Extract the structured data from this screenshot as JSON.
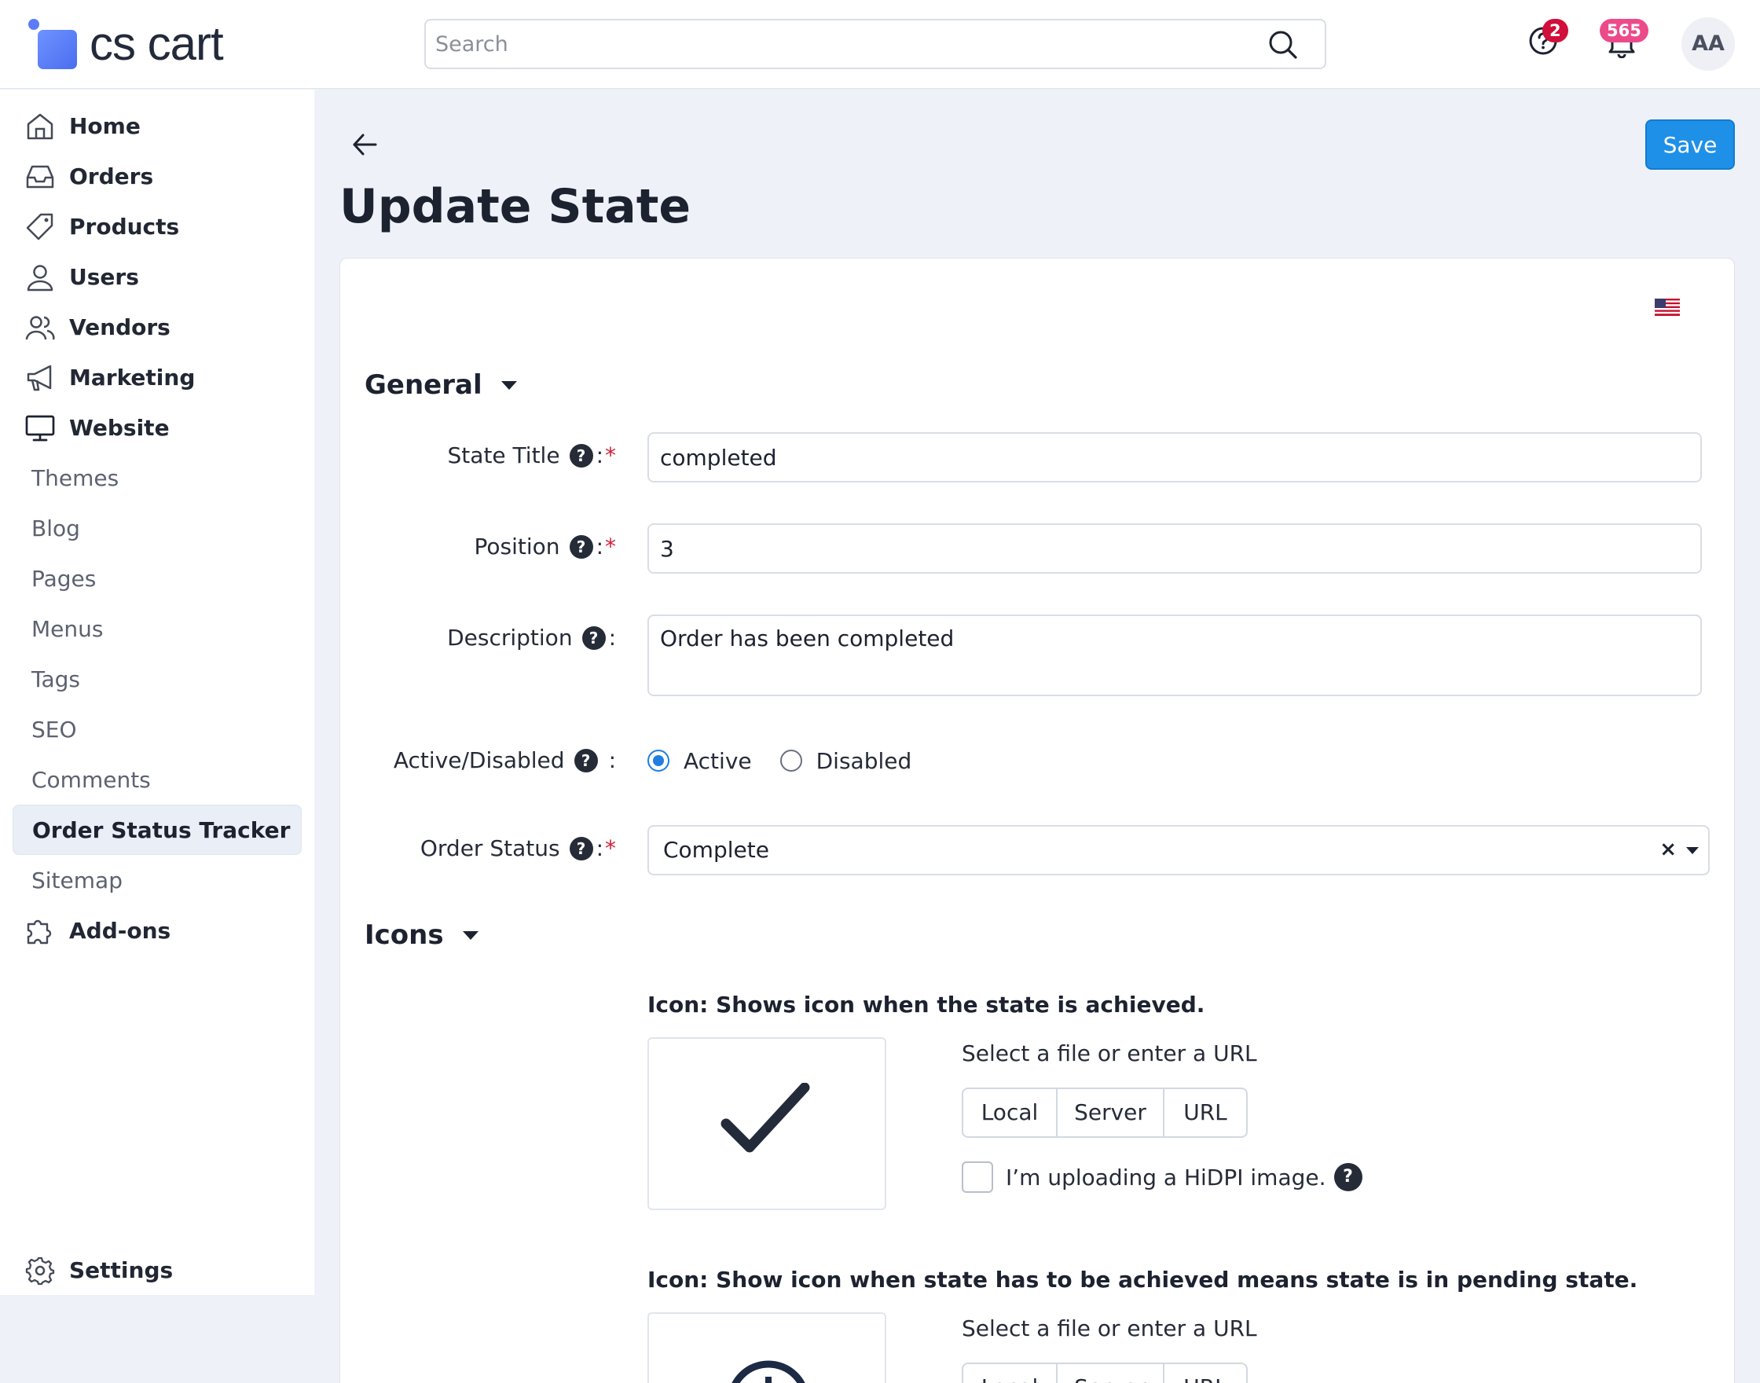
{
  "header": {
    "logo_text": "cs cart",
    "search": {
      "placeholder": "Search",
      "value": ""
    },
    "help_badge": "2",
    "notifications_badge": "565",
    "avatar_initials": "AA",
    "colors": {
      "help_badge": "#d0103a",
      "notifications_badge": "#ec4a8a"
    }
  },
  "sidebar": {
    "items": [
      {
        "label": "Home",
        "icon": "home-icon"
      },
      {
        "label": "Orders",
        "icon": "inbox-icon"
      },
      {
        "label": "Products",
        "icon": "tag-icon"
      },
      {
        "label": "Users",
        "icon": "user-icon"
      },
      {
        "label": "Vendors",
        "icon": "users-icon"
      },
      {
        "label": "Marketing",
        "icon": "megaphone-icon"
      },
      {
        "label": "Website",
        "icon": "monitor-icon"
      }
    ],
    "website_subitems": [
      {
        "label": "Themes"
      },
      {
        "label": "Blog"
      },
      {
        "label": "Pages"
      },
      {
        "label": "Menus"
      },
      {
        "label": "Tags"
      },
      {
        "label": "SEO"
      },
      {
        "label": "Comments"
      },
      {
        "label": "Order Status Tracker",
        "active": true
      },
      {
        "label": "Sitemap"
      }
    ],
    "addons": {
      "label": "Add-ons",
      "icon": "puzzle-icon"
    },
    "settings": {
      "label": "Settings",
      "icon": "gear-icon"
    }
  },
  "page": {
    "title": "Update State",
    "save_label": "Save",
    "accent_color": "#1e90e8"
  },
  "general": {
    "section_title": "General",
    "state_title": {
      "label": "State Title",
      "value": "completed"
    },
    "position": {
      "label": "Position",
      "value": "3"
    },
    "description": {
      "label": "Description",
      "value": "Order has been completed"
    },
    "active_disabled": {
      "label": "Active/Disabled",
      "options": [
        "Active",
        "Disabled"
      ],
      "selected": "Active"
    },
    "order_status": {
      "label": "Order Status",
      "value": "Complete",
      "clear": "×"
    }
  },
  "icons": {
    "section_title": "Icons",
    "achieved": {
      "heading": "Icon: Shows icon when the state is achieved.",
      "hint": "Select a file or enter a URL",
      "buttons": [
        "Local",
        "Server",
        "URL"
      ],
      "hidpi_label": "I’m uploading a HiDPI image.",
      "preview_icon": "checkmark-icon"
    },
    "pending": {
      "heading": "Icon: Show icon when state has to be achieved means state is in pending state.",
      "hint": "Select a file or enter a URL",
      "buttons": [
        "Local",
        "Server",
        "URL"
      ],
      "preview_icon": "clock-icon"
    }
  }
}
